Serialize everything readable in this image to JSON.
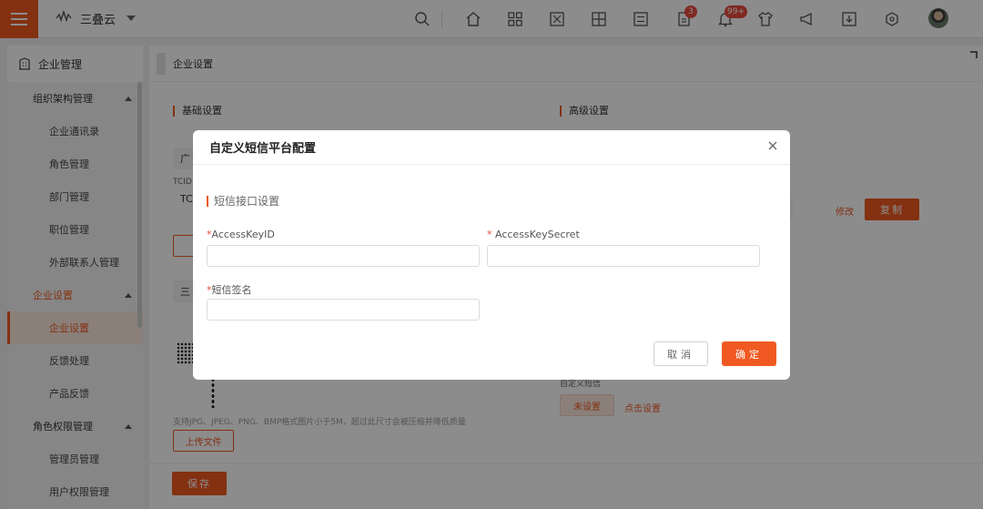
{
  "app": {
    "brand_name": "三叠云",
    "badges": {
      "tasks": "3",
      "notifications": "99+"
    }
  },
  "sidebar": {
    "header": "企业管理",
    "groups": [
      {
        "label": "组织架构管理",
        "items": [
          "企业通讯录",
          "角色管理",
          "部门管理",
          "职位管理",
          "外部联系人管理"
        ]
      },
      {
        "label": "企业设置",
        "items": [
          "企业设置",
          "反馈处理",
          "产品反馈"
        ]
      },
      {
        "label": "角色权限管理",
        "items": [
          "管理员管理",
          "用户权限管理"
        ]
      }
    ]
  },
  "main": {
    "breadcrumb": "企业设置",
    "basic_title": "基础设置",
    "advanced_title": "高级设置",
    "tcid_label": "TCID",
    "tcid_value": "TC",
    "company_field_value": "广",
    "company_name_value": "三",
    "modify_link": "修改",
    "copy_button": "复制",
    "upload_hint": "支持JPG、JPEG、PNG、BMP格式图片小于5M，超过此尺寸会被压缩并降低质量",
    "upload_button": "上传文件",
    "custom_sms_label": "自定义短信",
    "not_set_button": "未设置",
    "click_set_link": "点击设置",
    "save_button": "保存"
  },
  "modal": {
    "title": "自定义短信平台配置",
    "section": "短信接口设置",
    "fields": {
      "access_key_id": {
        "label": "AccessKeyID",
        "value": ""
      },
      "access_key_secret": {
        "label": "AccessKeySecret",
        "value": ""
      },
      "sms_signature": {
        "label": "短信签名",
        "value": ""
      }
    },
    "cancel_label": "取消",
    "ok_label": "确定"
  },
  "colors": {
    "accent": "#f05a22",
    "badge": "#e94b3c"
  }
}
